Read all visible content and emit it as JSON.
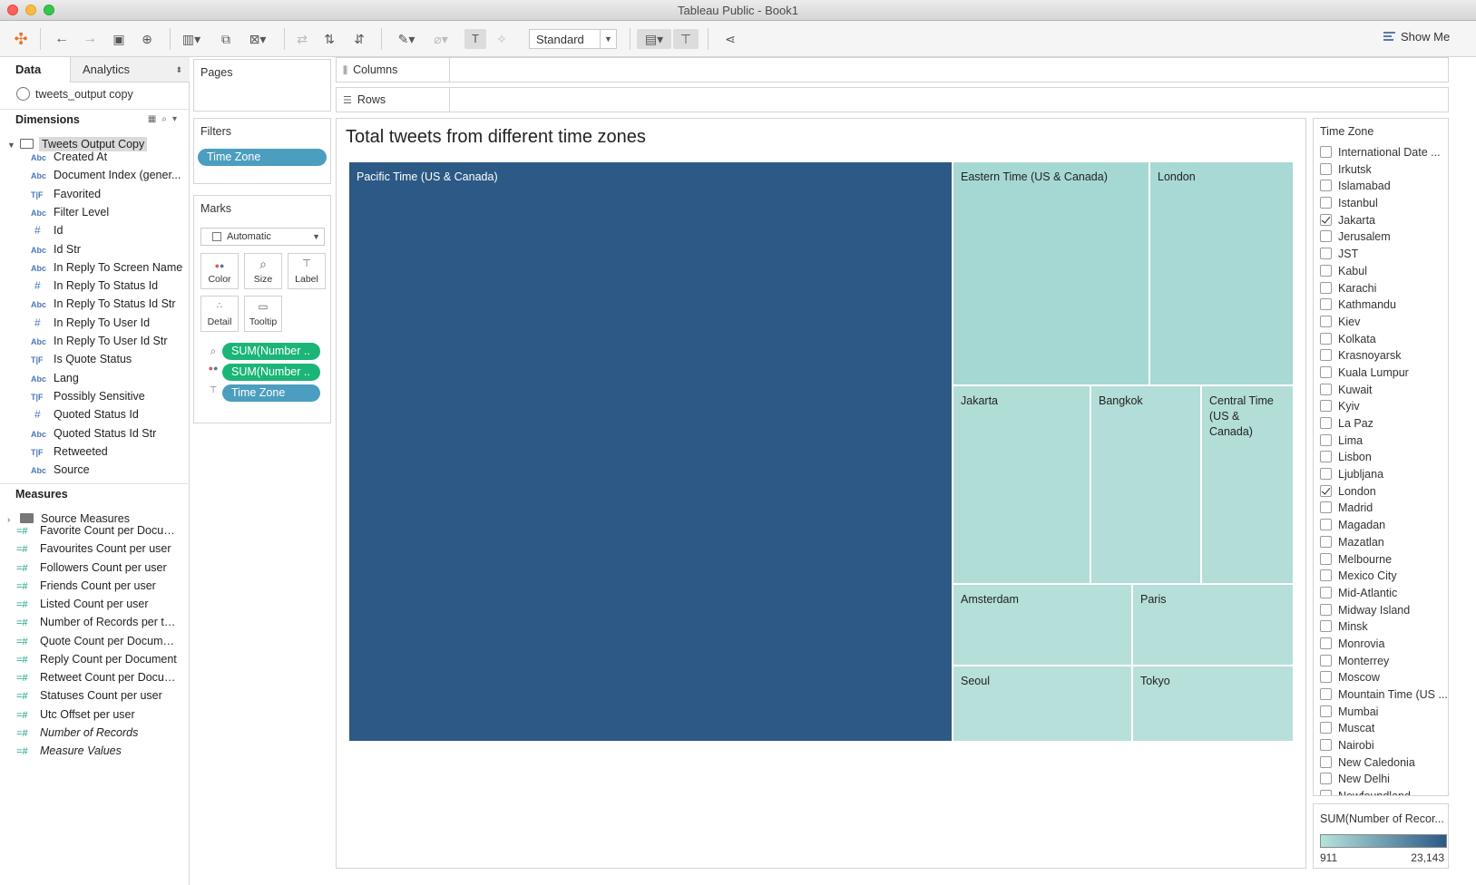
{
  "window": {
    "title": "Tableau Public - Book1"
  },
  "toolbar": {
    "fit": "Standard",
    "show_me": "Show Me"
  },
  "left_pane": {
    "tab_data": "Data",
    "tab_analytics": "Analytics",
    "datasource": "tweets_output copy",
    "dimensions_title": "Dimensions",
    "folder": "Tweets Output Copy",
    "dimensions": [
      {
        "type": "Abc",
        "name": "Created At"
      },
      {
        "type": "Abc",
        "name": "Document Index (gener..."
      },
      {
        "type": "T|F",
        "name": "Favorited"
      },
      {
        "type": "Abc",
        "name": "Filter Level"
      },
      {
        "type": "#",
        "name": "Id"
      },
      {
        "type": "Abc",
        "name": "Id Str"
      },
      {
        "type": "Abc",
        "name": "In Reply To Screen Name"
      },
      {
        "type": "#",
        "name": "In Reply To Status Id"
      },
      {
        "type": "Abc",
        "name": "In Reply To Status Id Str"
      },
      {
        "type": "#",
        "name": "In Reply To User Id"
      },
      {
        "type": "Abc",
        "name": "In Reply To User Id Str"
      },
      {
        "type": "T|F",
        "name": "Is Quote Status"
      },
      {
        "type": "Abc",
        "name": "Lang"
      },
      {
        "type": "T|F",
        "name": "Possibly Sensitive"
      },
      {
        "type": "#",
        "name": "Quoted Status Id"
      },
      {
        "type": "Abc",
        "name": "Quoted Status Id Str"
      },
      {
        "type": "T|F",
        "name": "Retweeted"
      },
      {
        "type": "Abc",
        "name": "Source"
      }
    ],
    "measures_title": "Measures",
    "measure_folder": "Source Measures",
    "measures": [
      {
        "name": "Favorite Count per Docum...",
        "italic": false
      },
      {
        "name": "Favourites Count per user",
        "italic": false
      },
      {
        "name": "Followers Count per user",
        "italic": false
      },
      {
        "name": "Friends Count per user",
        "italic": false
      },
      {
        "name": "Listed Count per user",
        "italic": false
      },
      {
        "name": "Number of Records per tw...",
        "italic": false
      },
      {
        "name": "Quote Count per Document",
        "italic": false
      },
      {
        "name": "Reply Count per Document",
        "italic": false
      },
      {
        "name": "Retweet Count per Docum...",
        "italic": false
      },
      {
        "name": "Statuses Count per user",
        "italic": false
      },
      {
        "name": "Utc Offset per user",
        "italic": false
      },
      {
        "name": "Number of Records",
        "italic": true
      },
      {
        "name": "Measure Values",
        "italic": true
      }
    ]
  },
  "pages": {
    "title": "Pages"
  },
  "filters": {
    "title": "Filters",
    "pill": "Time Zone"
  },
  "marks": {
    "title": "Marks",
    "type": "Automatic",
    "buttons": {
      "color": "Color",
      "size": "Size",
      "label": "Label",
      "detail": "Detail",
      "tooltip": "Tooltip"
    },
    "pills": [
      "SUM(Number ..",
      "SUM(Number ..",
      "Time Zone"
    ]
  },
  "shelves": {
    "columns": "Columns",
    "rows": "Rows"
  },
  "view": {
    "title": "Total tweets from different time zones",
    "tiles": [
      "Pacific Time (US & Canada)",
      "Eastern Time (US & Canada)",
      "London",
      "Jakarta",
      "Bangkok",
      "Central Time (US & Canada)",
      "Amsterdam",
      "Paris",
      "Seoul",
      "Tokyo"
    ]
  },
  "tz_filter": {
    "title": "Time Zone",
    "items": [
      {
        "label": "International Date ...",
        "checked": false
      },
      {
        "label": "Irkutsk",
        "checked": false
      },
      {
        "label": "Islamabad",
        "checked": false
      },
      {
        "label": "Istanbul",
        "checked": false
      },
      {
        "label": "Jakarta",
        "checked": true
      },
      {
        "label": "Jerusalem",
        "checked": false
      },
      {
        "label": "JST",
        "checked": false
      },
      {
        "label": "Kabul",
        "checked": false
      },
      {
        "label": "Karachi",
        "checked": false
      },
      {
        "label": "Kathmandu",
        "checked": false
      },
      {
        "label": "Kiev",
        "checked": false
      },
      {
        "label": "Kolkata",
        "checked": false
      },
      {
        "label": "Krasnoyarsk",
        "checked": false
      },
      {
        "label": "Kuala Lumpur",
        "checked": false
      },
      {
        "label": "Kuwait",
        "checked": false
      },
      {
        "label": "Kyiv",
        "checked": false
      },
      {
        "label": "La Paz",
        "checked": false
      },
      {
        "label": "Lima",
        "checked": false
      },
      {
        "label": "Lisbon",
        "checked": false
      },
      {
        "label": "Ljubljana",
        "checked": false
      },
      {
        "label": "London",
        "checked": true
      },
      {
        "label": "Madrid",
        "checked": false
      },
      {
        "label": "Magadan",
        "checked": false
      },
      {
        "label": "Mazatlan",
        "checked": false
      },
      {
        "label": "Melbourne",
        "checked": false
      },
      {
        "label": "Mexico City",
        "checked": false
      },
      {
        "label": "Mid-Atlantic",
        "checked": false
      },
      {
        "label": "Midway Island",
        "checked": false
      },
      {
        "label": "Minsk",
        "checked": false
      },
      {
        "label": "Monrovia",
        "checked": false
      },
      {
        "label": "Monterrey",
        "checked": false
      },
      {
        "label": "Moscow",
        "checked": false
      },
      {
        "label": "Mountain Time (US ...",
        "checked": false
      },
      {
        "label": "Mumbai",
        "checked": false
      },
      {
        "label": "Muscat",
        "checked": false
      },
      {
        "label": "Nairobi",
        "checked": false
      },
      {
        "label": "New Caledonia",
        "checked": false
      },
      {
        "label": "New Delhi",
        "checked": false
      },
      {
        "label": "Newfoundland",
        "checked": false
      }
    ]
  },
  "legend": {
    "title": "SUM(Number of Recor...",
    "min": "911",
    "max": "23,143",
    "color_low": "#b5e3dc",
    "color_high": "#2c5985"
  }
}
